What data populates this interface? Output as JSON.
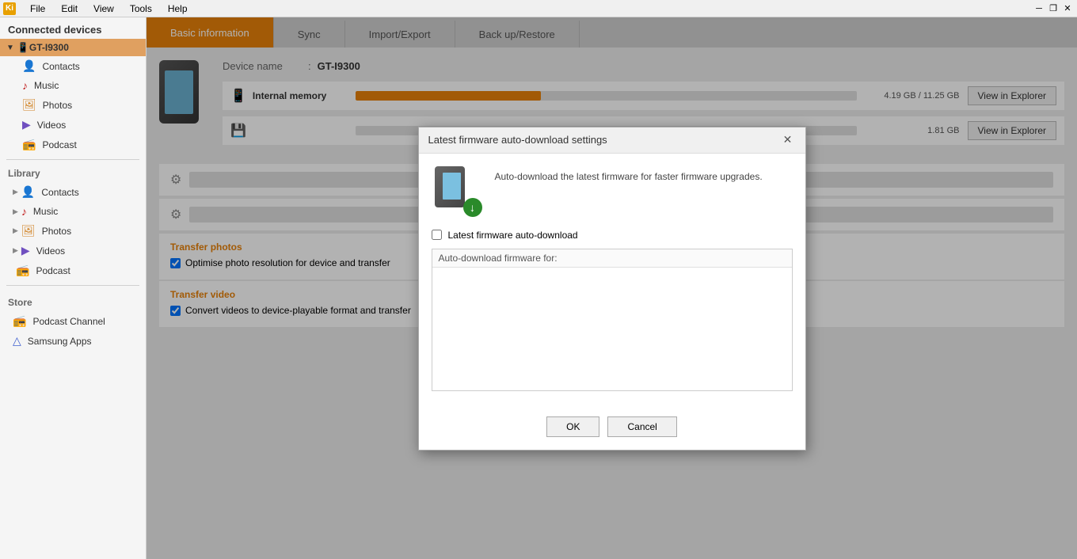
{
  "titlebar": {
    "logo": "Ki",
    "menus": [
      "File",
      "Edit",
      "View",
      "Tools",
      "Help"
    ],
    "controls": [
      "─",
      "❐",
      "✕"
    ]
  },
  "sidebar": {
    "connected_devices_label": "Connected devices",
    "device": {
      "name": "GT-I9300",
      "items": [
        {
          "label": "Contacts",
          "icon": "👤"
        },
        {
          "label": "Music",
          "icon": "♪"
        },
        {
          "label": "Photos",
          "icon": "🖼"
        },
        {
          "label": "Videos",
          "icon": "▶"
        },
        {
          "label": "Podcast",
          "icon": "📻"
        }
      ]
    },
    "library_label": "Library",
    "library_items": [
      {
        "label": "Contacts",
        "icon": "👤"
      },
      {
        "label": "Music",
        "icon": "♪"
      },
      {
        "label": "Photos",
        "icon": "🖼"
      },
      {
        "label": "Videos",
        "icon": "▶"
      },
      {
        "label": "Podcast",
        "icon": "📻"
      }
    ],
    "store_label": "Store",
    "store_items": [
      {
        "label": "Podcast Channel",
        "icon": "📻"
      },
      {
        "label": "Samsung Apps",
        "icon": "△"
      }
    ]
  },
  "tabs": [
    {
      "label": "Basic information",
      "active": true
    },
    {
      "label": "Sync",
      "active": false
    },
    {
      "label": "Import/Export",
      "active": false
    },
    {
      "label": "Back up/Restore",
      "active": false
    }
  ],
  "device_info": {
    "name_label": "Device name",
    "name_separator": ":",
    "name_value": "GT-I9300",
    "memories": [
      {
        "icon": "📱",
        "label": "Internal memory",
        "used_gb": 4.19,
        "total_gb": 11.25,
        "fill_percent": 37,
        "size_text": "4.19 GB / 11.25 GB",
        "bar_color": "#e8820a",
        "view_explorer": "View in Explorer"
      },
      {
        "icon": "💾",
        "label": "",
        "used_gb": 0,
        "total_gb": 0,
        "fill_percent": 0,
        "size_text": "1.81 GB",
        "bar_color": "#e8820a",
        "view_explorer": "View in Explorer"
      }
    ]
  },
  "transfer_photos": {
    "section_title": "Transfer photos",
    "checkbox_label": "Optimise photo resolution for device and transfer",
    "checked": true
  },
  "transfer_video": {
    "section_title": "Transfer video",
    "checkbox_label": "Convert videos to device-playable format and transfer",
    "checked": true
  },
  "modal": {
    "title": "Latest firmware auto-download settings",
    "description": "Auto-download the latest firmware for faster firmware upgrades.",
    "checkbox_label": "Latest firmware auto-download",
    "checkbox_checked": false,
    "textarea_label": "Auto-download firmware for:",
    "ok_button": "OK",
    "cancel_button": "Cancel",
    "close_symbol": "✕"
  }
}
